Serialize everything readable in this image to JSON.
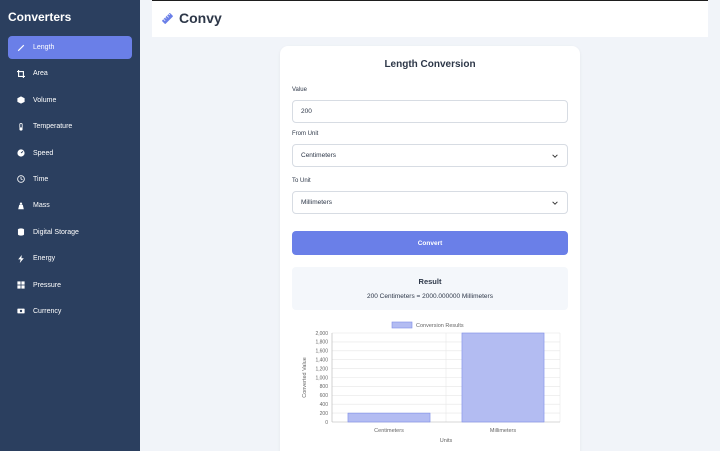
{
  "sidebar": {
    "title": "Converters",
    "items": [
      {
        "label": "Length",
        "icon": "ruler-icon",
        "active": true
      },
      {
        "label": "Area",
        "icon": "crop-icon"
      },
      {
        "label": "Volume",
        "icon": "cube-icon"
      },
      {
        "label": "Temperature",
        "icon": "thermometer-icon"
      },
      {
        "label": "Speed",
        "icon": "gauge-icon"
      },
      {
        "label": "Time",
        "icon": "clock-icon"
      },
      {
        "label": "Mass",
        "icon": "weight-icon"
      },
      {
        "label": "Digital Storage",
        "icon": "database-icon"
      },
      {
        "label": "Energy",
        "icon": "bolt-icon"
      },
      {
        "label": "Pressure",
        "icon": "grid-icon"
      },
      {
        "label": "Currency",
        "icon": "money-icon"
      }
    ]
  },
  "header": {
    "app_name": "Convy",
    "icon": "ruler-icon"
  },
  "converter": {
    "title": "Length Conversion",
    "value_label": "Value",
    "value": "200",
    "from_label": "From Unit",
    "from_value": "Centimeters",
    "to_label": "To Unit",
    "to_value": "Millimeters",
    "convert_label": "Convert",
    "result_title": "Result",
    "result_text": "200 Centimeters = 2000.000000 Millimeters"
  },
  "colors": {
    "sidebar_bg": "#2b3f5f",
    "accent": "#6a7fe8",
    "bar_fill": "#b3bcf2",
    "bar_stroke": "#7d8de8"
  },
  "chart_data": {
    "type": "bar",
    "categories": [
      "Centimeters",
      "Millimeters"
    ],
    "series": [
      {
        "name": "Conversion Results",
        "values": [
          200,
          2000
        ]
      }
    ],
    "xlabel": "Units",
    "ylabel": "Converted Value",
    "ylim": [
      0,
      2000
    ],
    "yticks": [
      "0",
      "200",
      "400",
      "600",
      "800",
      "1,000",
      "1,200",
      "1,400",
      "1,600",
      "1,800",
      "2,000"
    ],
    "legend": "top",
    "grid": true
  }
}
